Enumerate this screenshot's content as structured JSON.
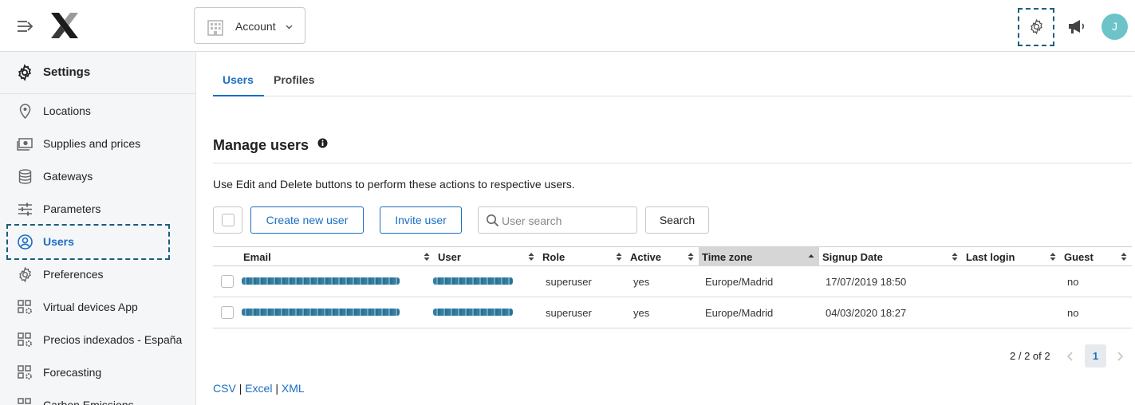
{
  "header": {
    "account_label": "Account",
    "avatar_initial": "J",
    "avatar_color": "#6cc4c9"
  },
  "sidebar": {
    "title": "Settings",
    "items": [
      {
        "label": "Locations",
        "icon": "map-pin-icon"
      },
      {
        "label": "Supplies and prices",
        "icon": "money-icon"
      },
      {
        "label": "Gateways",
        "icon": "database-icon"
      },
      {
        "label": "Parameters",
        "icon": "sliders-icon"
      },
      {
        "label": "Users",
        "icon": "user-circle-icon",
        "active": true
      },
      {
        "label": "Preferences",
        "icon": "gear-icon"
      },
      {
        "label": "Virtual devices App",
        "icon": "app-grid-gear-icon"
      },
      {
        "label": "Precios indexados - España",
        "icon": "app-grid-gear-icon"
      },
      {
        "label": "Forecasting",
        "icon": "app-grid-gear-icon"
      },
      {
        "label": "Carbon Emissions",
        "icon": "app-grid-gear-icon"
      }
    ]
  },
  "tabs": [
    {
      "label": "Users",
      "active": true
    },
    {
      "label": "Profiles",
      "active": false
    }
  ],
  "main": {
    "title": "Manage users",
    "description": "Use Edit and Delete buttons to perform these actions to respective users.",
    "create_label": "Create new user",
    "invite_label": "Invite user",
    "search_placeholder": "User search",
    "search_label": "Search"
  },
  "table": {
    "columns": [
      "Email",
      "User",
      "Role",
      "Active",
      "Time zone",
      "Signup Date",
      "Last login",
      "Guest"
    ],
    "sorted_column": "Time zone",
    "rows": [
      {
        "role": "superuser",
        "active": "yes",
        "timezone": "Europe/Madrid",
        "signup": "17/07/2019 18:50",
        "last_login": "",
        "guest": "no"
      },
      {
        "role": "superuser",
        "active": "yes",
        "timezone": "Europe/Madrid",
        "signup": "04/03/2020 18:27",
        "last_login": "",
        "guest": "no"
      }
    ]
  },
  "pagination": {
    "info": "2 / 2 of 2",
    "current_page": "1"
  },
  "export": {
    "csv": "CSV",
    "excel": "Excel",
    "xml": "XML",
    "separator": "|"
  },
  "colors": {
    "accent": "#1a6ec4",
    "highlight_dashed": "#1a5e7a"
  }
}
